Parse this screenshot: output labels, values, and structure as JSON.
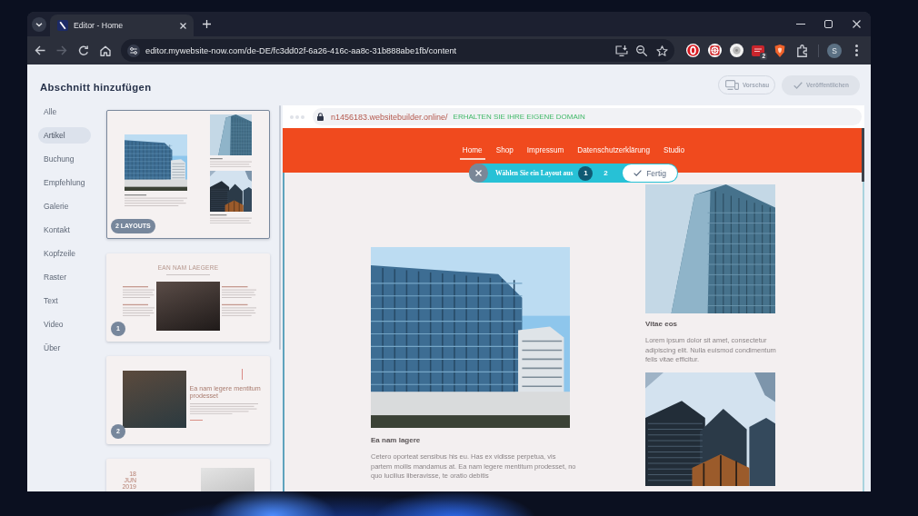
{
  "browser": {
    "tab": {
      "title": "Editor - Home"
    },
    "nav_buttons": [
      {
        "kind": "back",
        "disabled": false
      },
      {
        "kind": "forward",
        "disabled": true
      },
      {
        "kind": "reload",
        "disabled": false
      },
      {
        "kind": "home",
        "disabled": false
      }
    ],
    "address": {
      "url": "editor.mywebsite-now.com/de-DE/fc3dd02f-6a26-416c-aa8c-31b888abe1fb/content"
    },
    "extensions": [
      {
        "kind": "ring"
      },
      {
        "kind": "wheel"
      },
      {
        "kind": "disc"
      },
      {
        "kind": "tile",
        "badge": "2"
      },
      {
        "kind": "shield"
      }
    ],
    "profile": {
      "initial": "S"
    }
  },
  "editor": {
    "title": "Abschnitt hinzufügen",
    "categories": [
      {
        "label": "Alle",
        "selected": false
      },
      {
        "label": "Artikel",
        "selected": true
      },
      {
        "label": "Buchung",
        "selected": false
      },
      {
        "label": "Empfehlung",
        "selected": false
      },
      {
        "label": "Galerie",
        "selected": false
      },
      {
        "label": "Kontakt",
        "selected": false
      },
      {
        "label": "Kopfzeile",
        "selected": false
      },
      {
        "label": "Raster",
        "selected": false
      },
      {
        "label": "Text",
        "selected": false
      },
      {
        "label": "Video",
        "selected": false
      },
      {
        "label": "Über",
        "selected": false
      }
    ],
    "layouts": [
      {
        "kind": "article",
        "badge": "2 LAYOUTS",
        "selected": true
      },
      {
        "kind": "feature",
        "heading": "EAN NAM LAEGERE",
        "badge": "1",
        "selected": false
      },
      {
        "kind": "story",
        "heading": "Ea nam legere mentitum prodesset",
        "badge": "2",
        "selected": false
      },
      {
        "kind": "event",
        "date": "18 JUN 2019",
        "selected": false
      }
    ],
    "actions": [
      {
        "kind": "preview",
        "label": "Vorschau",
        "disabled": true
      },
      {
        "kind": "publish",
        "label": "Veröffentlichen",
        "disabled": true
      }
    ]
  },
  "preview": {
    "url": "n1456183.websitebuilder.online/",
    "domain_offer": "ERHALTEN SIE IHRE EIGENE DOMAIN",
    "nav": [
      {
        "label": "Home",
        "selected": true
      },
      {
        "label": "Shop",
        "selected": false
      },
      {
        "label": "Impressum",
        "selected": false
      },
      {
        "label": "Datenschutzerklärung",
        "selected": false
      },
      {
        "label": "Studio",
        "selected": false
      }
    ],
    "layout_picker": {
      "label": "Wählen Sie ein Layout aus",
      "options": [
        {
          "label": "1",
          "selected": true
        },
        {
          "label": "2",
          "selected": false
        }
      ],
      "done": "Fertig"
    },
    "columns": [
      {
        "kind": "wide",
        "heading": "Ea nam lagere",
        "text": "Cetero oporteat sensibus his eu. Has ex vidisse perpetua, vis partem mollis mandamus at. Ea nam legere mentitum prodesset, no quo lucilius liberavisse, te oratio debitis"
      },
      {
        "kind": "stack",
        "heading": "Vitae eos",
        "text": "Lorem ipsum dolor sit amet, consectetur adipiscing elit. Nulla euismod condimentum felis vitae efficitur."
      }
    ]
  }
}
